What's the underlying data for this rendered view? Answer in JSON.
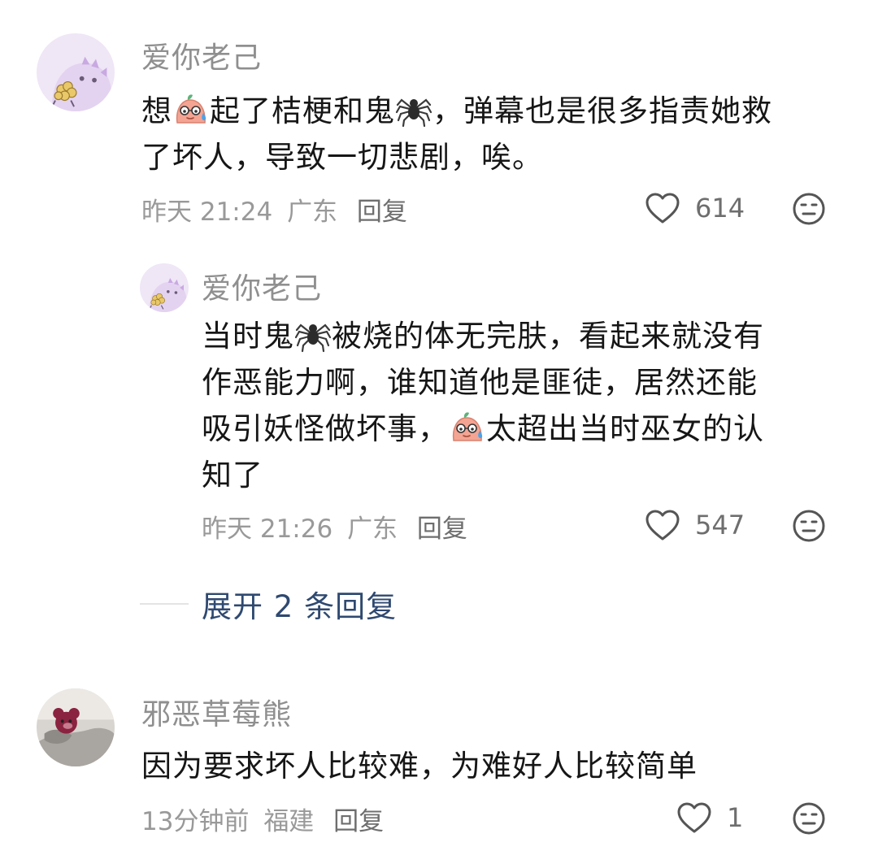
{
  "comments": [
    {
      "username": "爱你老己",
      "content_lines": [
        [
          "想",
          "emoji:sweat-face",
          "起了桔梗和鬼",
          "emoji:spider",
          "，弹幕也是很多指责她救"
        ],
        [
          "了坏人，导致一切悲剧，唉。"
        ]
      ],
      "time": "昨天 21:24",
      "location": "广东",
      "reply_label": "回复",
      "likes": "614"
    },
    {
      "username": "爱你老己",
      "content_lines": [
        [
          "当时鬼",
          "emoji:spider",
          "被烧的体无完肤，看起来就没有"
        ],
        [
          "作恶能力啊，谁知道他是匪徒，居然还能"
        ],
        [
          "吸引妖怪做坏事，",
          "emoji:sweat-face",
          "太超出当时巫女的认"
        ],
        [
          "知了"
        ]
      ],
      "time": "昨天 21:26",
      "location": "广东",
      "reply_label": "回复",
      "likes": "547"
    },
    {
      "username": "邪恶草莓熊",
      "content_lines": [
        [
          "因为要求坏人比较难，为难好人比较简单"
        ]
      ],
      "time": "13分钟前",
      "location": "福建",
      "reply_label": "回复",
      "likes": "1"
    }
  ],
  "expand_replies": "展开 2 条回复",
  "icons": {
    "like": "heart-outline-icon",
    "dislike": "meh-face-icon",
    "spider": "spider-emoji",
    "sweat": "sweat-face-emoji"
  },
  "colors": {
    "username": "#8f8f8f",
    "meta": "#999999",
    "expand_link": "#2f4970",
    "avatar_bg": "#efe6f6"
  }
}
